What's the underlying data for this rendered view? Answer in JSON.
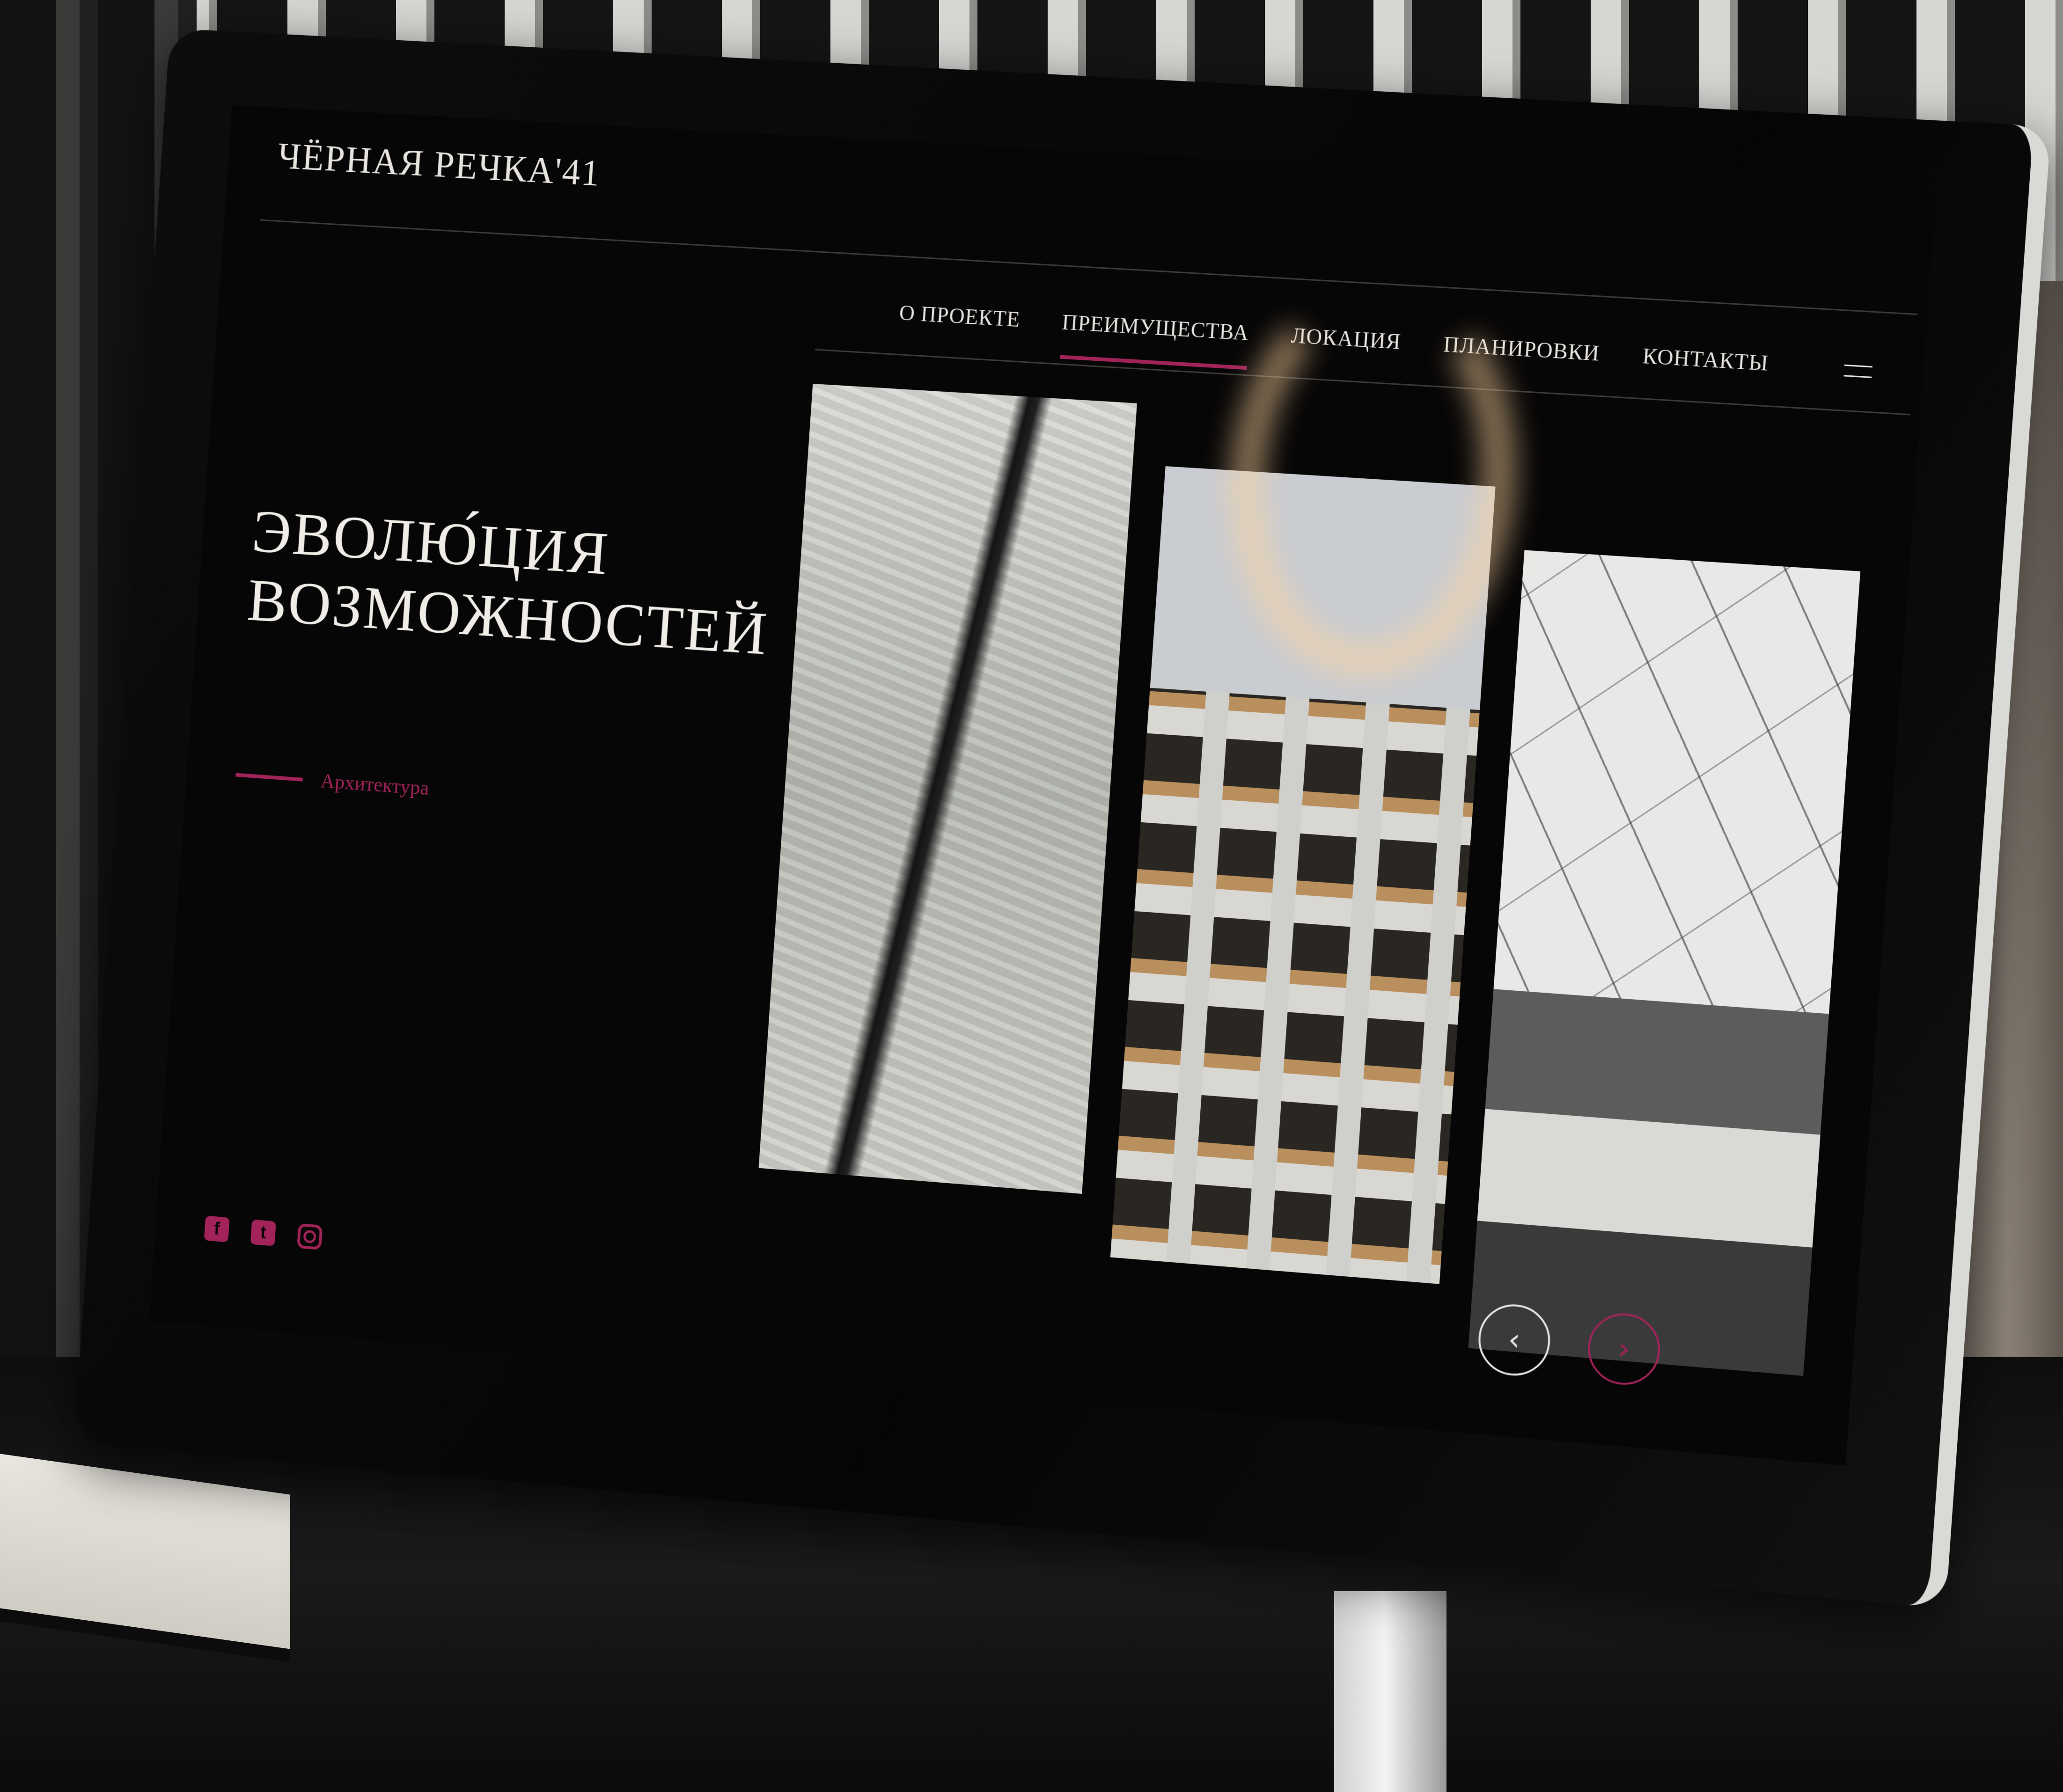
{
  "site": {
    "logo": "ЧЁРНАЯ РЕЧКА'41",
    "nav": {
      "items": [
        {
          "label": "О ПРОЕКТЕ"
        },
        {
          "label": "ПРЕИМУЩЕСТВА"
        },
        {
          "label": "ЛОКАЦИЯ"
        },
        {
          "label": "ПЛАНИРОВКИ"
        },
        {
          "label": "КОНТАКТЫ"
        }
      ],
      "active_index": 1
    },
    "hero": {
      "headline_line1": "ЭВОЛЮ́ЦИЯ",
      "headline_line2": "ВОЗМОЖНОСТЕЙ",
      "category": "Архитектура"
    },
    "gallery": {
      "panels": [
        {
          "icon": "stone-texture-image"
        },
        {
          "icon": "building-facade-image"
        },
        {
          "icon": "marble-interior-image"
        }
      ]
    },
    "controls": {
      "prev_icon": "‹",
      "next_icon": "›"
    },
    "social": {
      "facebook_glyph": "f",
      "twitter_glyph": "t",
      "instagram_glyph": ""
    }
  },
  "colors": {
    "accent": "#a2235a",
    "background": "#070606",
    "text": "#e7e3de"
  }
}
